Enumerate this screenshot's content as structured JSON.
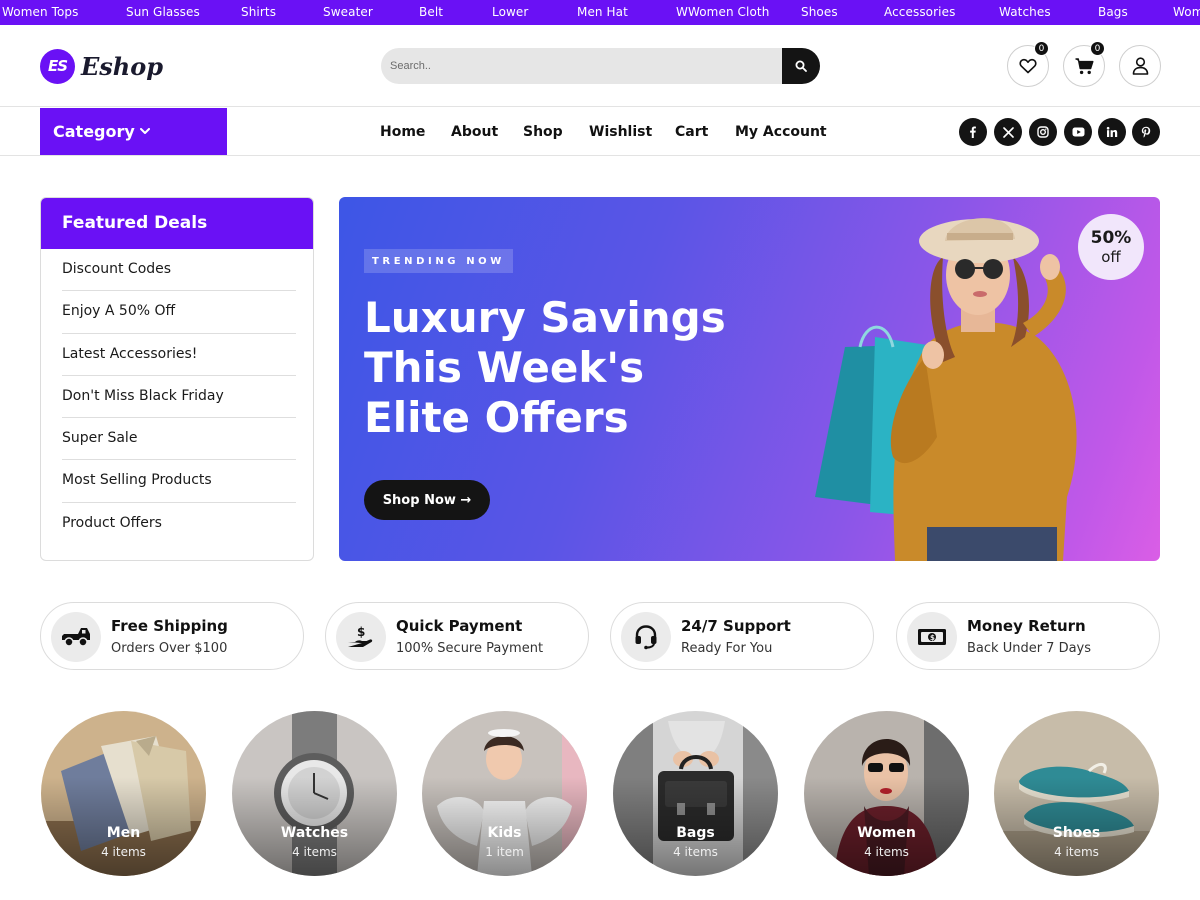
{
  "ticker": {
    "items": [
      "Women Tops",
      "Sun Glasses",
      "Shirts",
      "Sweater",
      "Belt",
      "Lower",
      "Men Hat",
      "WWomen Cloth",
      "Shoes",
      "Accessories",
      "Watches",
      "Bags",
      "Women"
    ]
  },
  "header": {
    "logo_mark": "ES",
    "logo_text": "Eshop",
    "search_placeholder": "Search..",
    "wishlist_count": "0",
    "cart_count": "0"
  },
  "nav": {
    "category_label": "Category",
    "menu": [
      "Home",
      "About",
      "Shop",
      "Wishlist",
      "Cart",
      "My Account"
    ],
    "social_icons": [
      "facebook-icon",
      "x-icon",
      "instagram-icon",
      "youtube-icon",
      "linkedin-icon",
      "pinterest-icon"
    ]
  },
  "deals": {
    "title": "Featured Deals",
    "items": [
      "Discount Codes",
      "Enjoy A 50% Off",
      "Latest Accessories!",
      "Don't Miss Black Friday",
      "Super Sale",
      "Most Selling Products",
      "Product Offers"
    ]
  },
  "hero": {
    "tag": "TRENDING NOW",
    "title_lines": [
      "Luxury Savings",
      "This Week's",
      "Elite Offers"
    ],
    "button": "Shop Now →",
    "badge_value": "50%",
    "badge_label": "off"
  },
  "features": [
    {
      "icon": "truck-icon",
      "title": "Free Shipping",
      "subtitle": "Orders Over $100"
    },
    {
      "icon": "payment-hand-icon",
      "title": "Quick Payment",
      "subtitle": "100% Secure Payment"
    },
    {
      "icon": "headset-icon",
      "title": "24/7 Support",
      "subtitle": "Ready For You"
    },
    {
      "icon": "money-icon",
      "title": "Money Return",
      "subtitle": "Back Under 7 Days"
    }
  ],
  "categories": [
    {
      "name": "Men",
      "count": "4 items"
    },
    {
      "name": "Watches",
      "count": "4 items"
    },
    {
      "name": "Kids",
      "count": "1 item"
    },
    {
      "name": "Bags",
      "count": "4 items"
    },
    {
      "name": "Women",
      "count": "4 items"
    },
    {
      "name": "Shoes",
      "count": "4 items"
    }
  ],
  "colors": {
    "brand": "#6a11f5",
    "dark": "#141414"
  }
}
